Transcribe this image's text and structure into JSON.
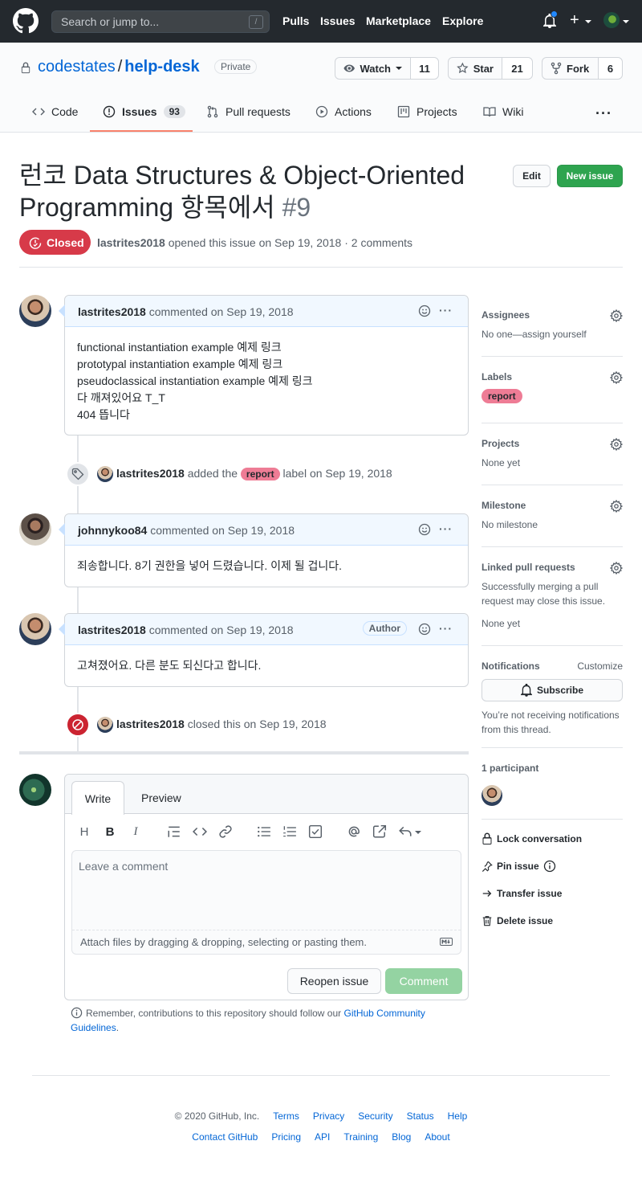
{
  "header": {
    "search_placeholder": "Search or jump to...",
    "slash_key": "/",
    "nav": [
      "Pulls",
      "Issues",
      "Marketplace",
      "Explore"
    ]
  },
  "repo": {
    "owner": "codestates",
    "separator": "/",
    "name": "help-desk",
    "visibility": "Private",
    "watch_label": "Watch",
    "watch_count": "11",
    "star_label": "Star",
    "star_count": "21",
    "fork_label": "Fork",
    "fork_count": "6",
    "tabs": [
      {
        "label": "Code"
      },
      {
        "label": "Issues",
        "count": "93"
      },
      {
        "label": "Pull requests"
      },
      {
        "label": "Actions"
      },
      {
        "label": "Projects"
      },
      {
        "label": "Wiki"
      }
    ],
    "more": "···"
  },
  "issue": {
    "title_line1": "런코 Data Structures & Object-Oriented",
    "title_line2": "Programming 항목에서",
    "number": "#9",
    "edit_label": "Edit",
    "new_issue_label": "New issue",
    "state": "Closed",
    "author": "lastrites2018",
    "meta": "opened this issue on Sep 19, 2018 · 2 comments"
  },
  "timeline": {
    "comment1": {
      "author": "lastrites2018",
      "when": "commented on Sep 19, 2018",
      "lines": [
        "functional instantiation example 예제 링크",
        "prototypal instantiation example 예제 링크",
        "pseudoclassical instantiation example 예제 링크",
        "다 깨져있어요 T_T",
        "404 뜹니다"
      ]
    },
    "label_event": {
      "actor": "lastrites2018",
      "pre": "added the",
      "label": "report",
      "post": "label on Sep 19, 2018"
    },
    "comment2": {
      "author": "johnnykoo84",
      "when": "commented on Sep 19, 2018",
      "body": "죄송합니다. 8기 권한을 넣어 드렸습니다. 이제 될 겁니다."
    },
    "comment3": {
      "author": "lastrites2018",
      "when": "commented on Sep 19, 2018",
      "badge": "Author",
      "body": "고쳐졌어요. 다른 분도 되신다고 합니다."
    },
    "close_event": {
      "actor": "lastrites2018",
      "text": "closed this on Sep 19, 2018"
    },
    "kebab": "···"
  },
  "composer": {
    "write_tab": "Write",
    "preview_tab": "Preview",
    "toolbar": [
      "H",
      "B",
      "I"
    ],
    "placeholder": "Leave a comment",
    "attach_hint": "Attach files by dragging & dropping, selecting or pasting them.",
    "reopen_label": "Reopen issue",
    "comment_label": "Comment",
    "reminder_text": "Remember, contributions to this repository should follow our",
    "reminder_link": "GitHub Community Guidelines",
    "reminder_end": "."
  },
  "sidebar": {
    "assignees_title": "Assignees",
    "assignees_value": "No one—assign yourself",
    "labels_title": "Labels",
    "label": "report",
    "projects_title": "Projects",
    "projects_value": "None yet",
    "milestone_title": "Milestone",
    "milestone_value": "No milestone",
    "linked_title": "Linked pull requests",
    "linked_value": "Successfully merging a pull request may close this issue.",
    "linked_none": "None yet",
    "notifications_title": "Notifications",
    "customize": "Customize",
    "subscribe": "Subscribe",
    "notify_text": "You’re not receiving notifications from this thread.",
    "participants": "1 participant",
    "lock": "Lock conversation",
    "pin": "Pin issue",
    "transfer": "Transfer issue",
    "delete": "Delete issue"
  },
  "footer": {
    "copyright": "© 2020 GitHub, Inc.",
    "row1": [
      "Terms",
      "Privacy",
      "Security",
      "Status",
      "Help"
    ],
    "row2": [
      "Contact GitHub",
      "Pricing",
      "API",
      "Training",
      "Blog",
      "About"
    ]
  },
  "colors": {
    "header_bg": "#24292e",
    "link": "#0366d6",
    "closed": "#d73a49",
    "new_issue": "#2ea44f",
    "label_report": "#ee7c95",
    "tab_underline": "#f9826c"
  }
}
